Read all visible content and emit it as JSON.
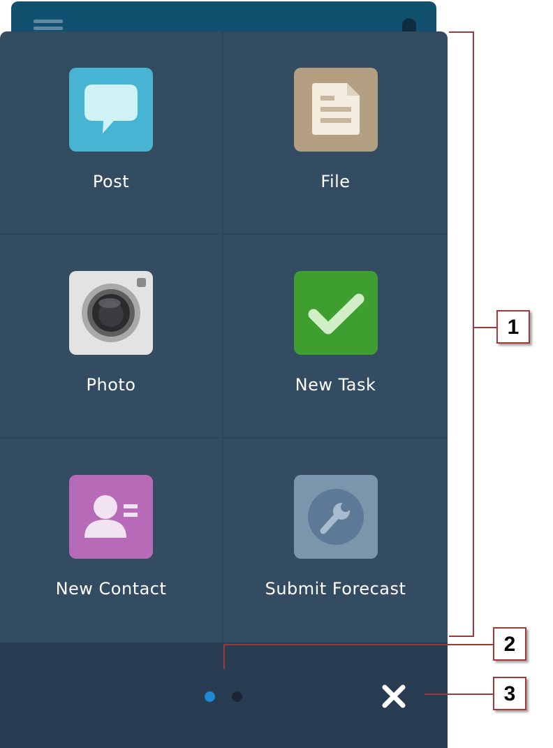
{
  "actions": [
    {
      "label": "Post",
      "icon": "chat-bubble-icon",
      "color": "#46b4d2"
    },
    {
      "label": "File",
      "icon": "document-icon",
      "color": "#b39f82"
    },
    {
      "label": "Photo",
      "icon": "camera-icon",
      "color": "#e3e3e3"
    },
    {
      "label": "New Task",
      "icon": "checkmark-icon",
      "color": "#3e9e30"
    },
    {
      "label": "New Contact",
      "icon": "contact-card-icon",
      "color": "#b66ab8"
    },
    {
      "label": "Submit Forecast",
      "icon": "wrench-icon",
      "color": "#7b95ad"
    }
  ],
  "pagination": {
    "total_pages": 2,
    "current_page": 1,
    "active_color": "#1f8ad2"
  },
  "close_icon": "close-icon",
  "callouts": [
    "1",
    "2",
    "3"
  ],
  "colors": {
    "panel": "#344c62",
    "footer": "#293d52",
    "callout": "#a1383a"
  }
}
